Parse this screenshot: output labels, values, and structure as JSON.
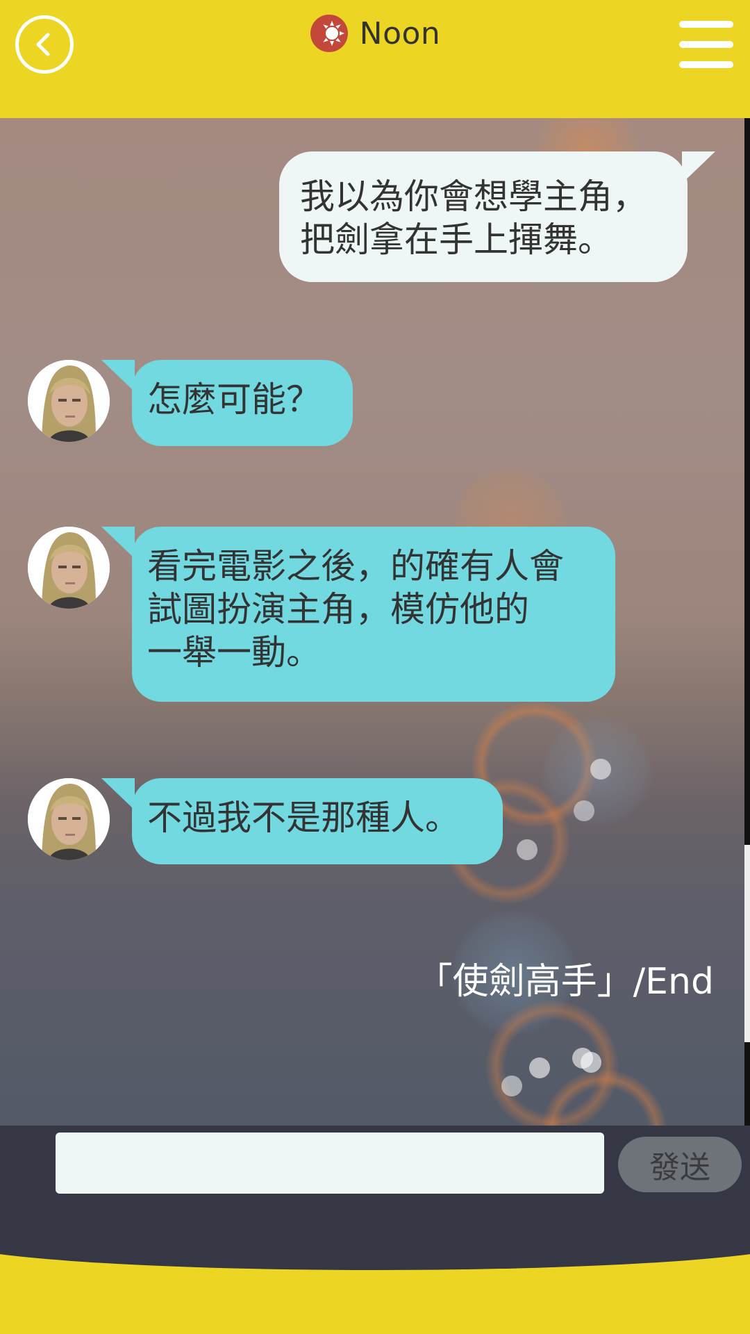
{
  "header": {
    "title": "Noon",
    "back_icon": "back-arrow-icon",
    "status_icon": "sun-icon",
    "menu_icon": "hamburger-menu-icon"
  },
  "messages": [
    {
      "side": "out",
      "lines": [
        "我以為你會想學主角，",
        "把劍拿在手上揮舞。"
      ]
    },
    {
      "side": "in",
      "lines": [
        "怎麼可能？"
      ]
    },
    {
      "side": "in",
      "lines": [
        "看完電影之後，的確有人會",
        "試圖扮演主角，模仿他的",
        "一舉一動。"
      ]
    },
    {
      "side": "in",
      "lines": [
        "不過我不是那種人。"
      ]
    }
  ],
  "end_label": "「使劍高手」/End",
  "input": {
    "value": "",
    "placeholder": ""
  },
  "send_label": "發送",
  "colors": {
    "header": "#ecd623",
    "outgoing_bubble": "#eef7f6",
    "incoming_bubble": "#72d9e1",
    "input_bar": "#363745",
    "sun_icon": "#c4473c"
  }
}
